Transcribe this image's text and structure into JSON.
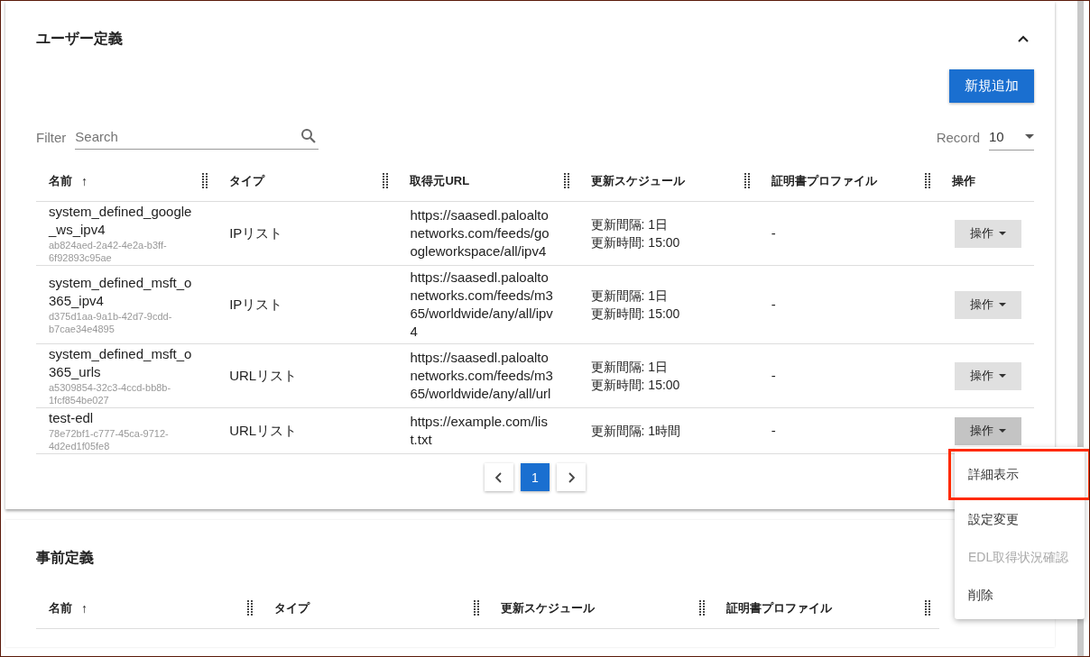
{
  "user_section": {
    "title": "ユーザー定義",
    "expanded": true,
    "add_button": "新規追加",
    "filter": {
      "label": "Filter",
      "placeholder": "Search"
    },
    "record": {
      "label": "Record",
      "value": "10"
    },
    "columns": [
      {
        "label": "名前",
        "sort": "↑"
      },
      {
        "label": "タイプ"
      },
      {
        "label": "取得元URL"
      },
      {
        "label": "更新スケジュール"
      },
      {
        "label": "証明書プロファイル"
      },
      {
        "label": "操作"
      }
    ],
    "rows": [
      {
        "name": "system_defined_google_ws_ipv4",
        "id": "ab824aed-2a42-4e2a-b3ff-6f92893c95ae",
        "type": "IPリスト",
        "url": "https://saasedl.paloaltonetworks.com/feeds/googleworkspace/all/ipv4",
        "schedule": [
          "更新間隔: 1日",
          "更新時間: 15:00"
        ],
        "cert": "-",
        "action": "操作",
        "menu_open": false
      },
      {
        "name": "system_defined_msft_o365_ipv4",
        "id": "d375d1aa-9a1b-42d7-9cdd-b7cae34e4895",
        "type": "IPリスト",
        "url": "https://saasedl.paloaltonetworks.com/feeds/m365/worldwide/any/all/ipv4",
        "schedule": [
          "更新間隔: 1日",
          "更新時間: 15:00"
        ],
        "cert": "-",
        "action": "操作",
        "menu_open": false
      },
      {
        "name": "system_defined_msft_o365_urls",
        "id": "a5309854-32c3-4ccd-bb8b-1fcf854be027",
        "type": "URLリスト",
        "url": "https://saasedl.paloaltonetworks.com/feeds/m365/worldwide/any/all/url",
        "schedule": [
          "更新間隔: 1日",
          "更新時間: 15:00"
        ],
        "cert": "-",
        "action": "操作",
        "menu_open": false
      },
      {
        "name": "test-edl",
        "id": "78e72bf1-c777-45ca-9712-4d2ed1f05fe8",
        "type": "URLリスト",
        "url": "https://example.com/list.txt",
        "schedule": [
          "更新間隔: 1時間"
        ],
        "cert": "-",
        "action": "操作",
        "menu_open": true
      }
    ],
    "pagination": [
      {
        "label": "1",
        "selected": true
      }
    ],
    "action_menu": [
      {
        "label": "詳細表示",
        "highlighted": true,
        "disabled": false
      },
      {
        "label": "設定変更",
        "highlighted": false,
        "disabled": false
      },
      {
        "label": "EDL取得状況確認",
        "highlighted": false,
        "disabled": true
      },
      {
        "label": "削除",
        "highlighted": false,
        "disabled": false
      }
    ]
  },
  "predefined_section": {
    "title": "事前定義",
    "columns": [
      {
        "label": "名前",
        "sort": "↑"
      },
      {
        "label": "タイプ"
      },
      {
        "label": "更新スケジュール"
      },
      {
        "label": "証明書プロファイル"
      }
    ]
  }
}
